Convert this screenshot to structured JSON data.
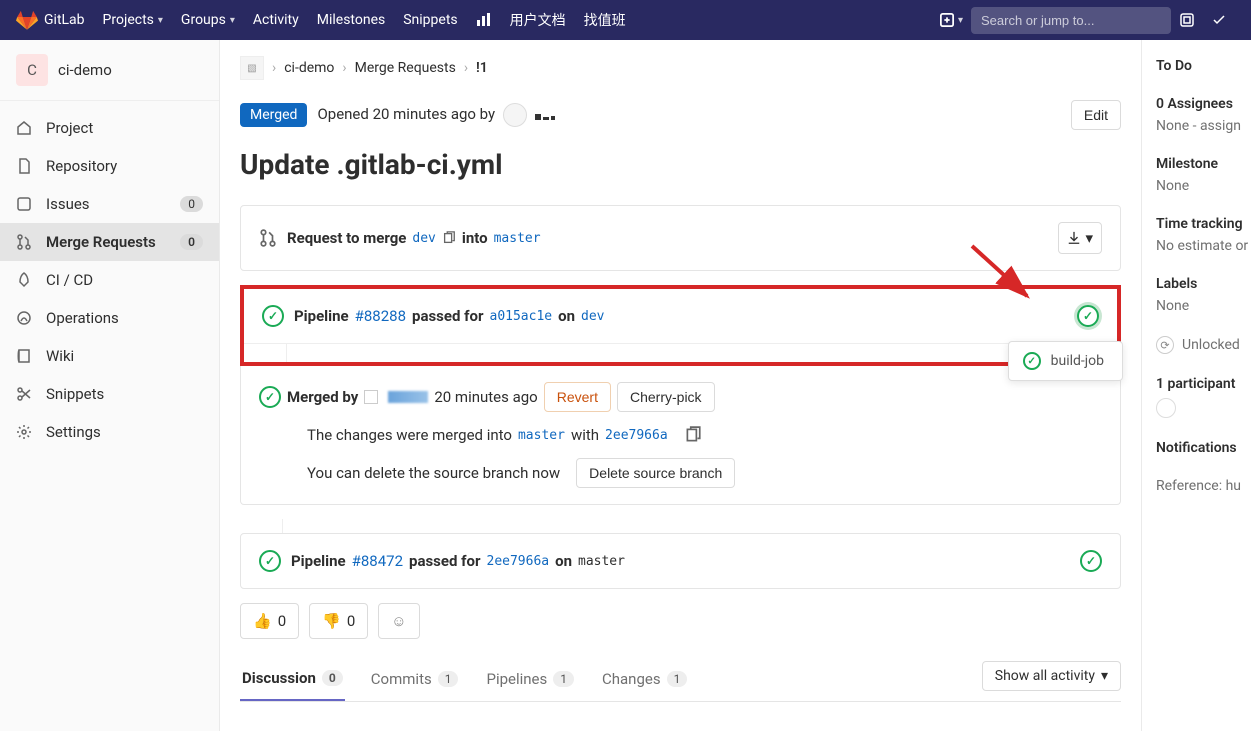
{
  "brand": "GitLab",
  "topnav": {
    "projects": "Projects",
    "groups": "Groups",
    "activity": "Activity",
    "milestones": "Milestones",
    "snippets": "Snippets",
    "user_docs": "用户文档",
    "find_class": "找值班",
    "search_placeholder": "Search or jump to..."
  },
  "project": {
    "initial": "C",
    "name": "ci-demo"
  },
  "sidebar": {
    "project": "Project",
    "repository": "Repository",
    "issues": "Issues",
    "issues_count": "0",
    "merge_requests": "Merge Requests",
    "mr_count": "0",
    "cicd": "CI / CD",
    "operations": "Operations",
    "wiki": "Wiki",
    "snippets": "Snippets",
    "settings": "Settings"
  },
  "breadcrumbs": {
    "project": "ci-demo",
    "section": "Merge Requests",
    "ref": "!1"
  },
  "mr": {
    "status": "Merged",
    "opened": "Opened 20 minutes ago by",
    "edit": "Edit",
    "title": "Update .gitlab-ci.yml"
  },
  "merge_widget": {
    "request_to_merge": "Request to merge",
    "source_branch": "dev",
    "into": "into",
    "target_branch": "master"
  },
  "pipeline1": {
    "label": "Pipeline",
    "id": "#88288",
    "passed_for": "passed for",
    "commit": "a015ac1e",
    "on": "on",
    "branch": "dev",
    "job_popover": "build-job"
  },
  "merged_section": {
    "merged_by": "Merged by",
    "time": "20 minutes ago",
    "revert": "Revert",
    "cherry_pick": "Cherry-pick",
    "changes_merged_into": "The changes were merged into",
    "target": "master",
    "with": "with",
    "commit": "2ee7966a",
    "delete_prompt": "You can delete the source branch now",
    "delete_btn": "Delete source branch"
  },
  "pipeline2": {
    "label": "Pipeline",
    "id": "#88472",
    "passed_for": "passed for",
    "commit": "2ee7966a",
    "on": "on",
    "branch": "master"
  },
  "reactions": {
    "thumbs_up": "0",
    "thumbs_down": "0"
  },
  "tabs": {
    "discussion": "Discussion",
    "discussion_count": "0",
    "commits": "Commits",
    "commits_count": "1",
    "pipelines": "Pipelines",
    "pipelines_count": "1",
    "changes": "Changes",
    "changes_count": "1",
    "show_all": "Show all activity"
  },
  "right": {
    "todo": "To Do",
    "assignees": "0 Assignees",
    "assignees_val": "None - assign",
    "milestone": "Milestone",
    "milestone_val": "None",
    "time_tracking": "Time tracking",
    "time_val": "No estimate or",
    "labels": "Labels",
    "labels_val": "None",
    "locked": "Unlocked",
    "participant": "1 participant",
    "notifications": "Notifications",
    "reference": "Reference: hu"
  }
}
